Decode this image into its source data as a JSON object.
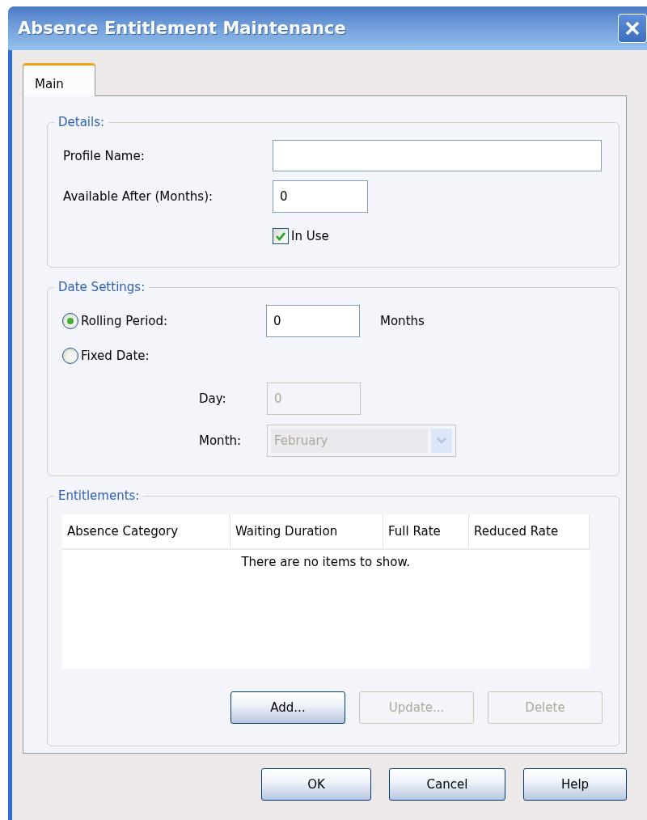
{
  "window": {
    "title": "Absence Entitlement Maintenance"
  },
  "tabs": [
    {
      "label": "Main",
      "selected": true
    }
  ],
  "details": {
    "legend": "Details:",
    "profile_name": {
      "label": "Profile Name:"
    },
    "available_after": {
      "label": "Available After (Months):",
      "value": "0"
    },
    "in_use": {
      "label": "In Use",
      "checked": true
    }
  },
  "date_settings": {
    "legend": "Date Settings:",
    "options": [
      {
        "label": "Rolling Period:",
        "selected": true
      },
      {
        "label": "Fixed Date:",
        "selected": false
      }
    ],
    "rolling_period": {
      "value": "0",
      "unit": "Months"
    },
    "day": {
      "label": "Day:",
      "value": "0",
      "disabled": true
    },
    "month": {
      "label": "Month:",
      "value": "February",
      "disabled": true
    }
  },
  "entitlements": {
    "legend": "Entitlements:",
    "columns": [
      "Absence Category",
      "Waiting Duration",
      "Full Rate",
      "Reduced Rate"
    ],
    "empty_text": "There are no items to show.",
    "buttons": [
      {
        "label": "Add...",
        "disabled": false
      },
      {
        "label": "Update...",
        "disabled": true
      },
      {
        "label": "Delete",
        "disabled": true
      }
    ]
  },
  "buttons": [
    {
      "label": "OK"
    },
    {
      "label": "Cancel"
    },
    {
      "label": "Help"
    }
  ]
}
